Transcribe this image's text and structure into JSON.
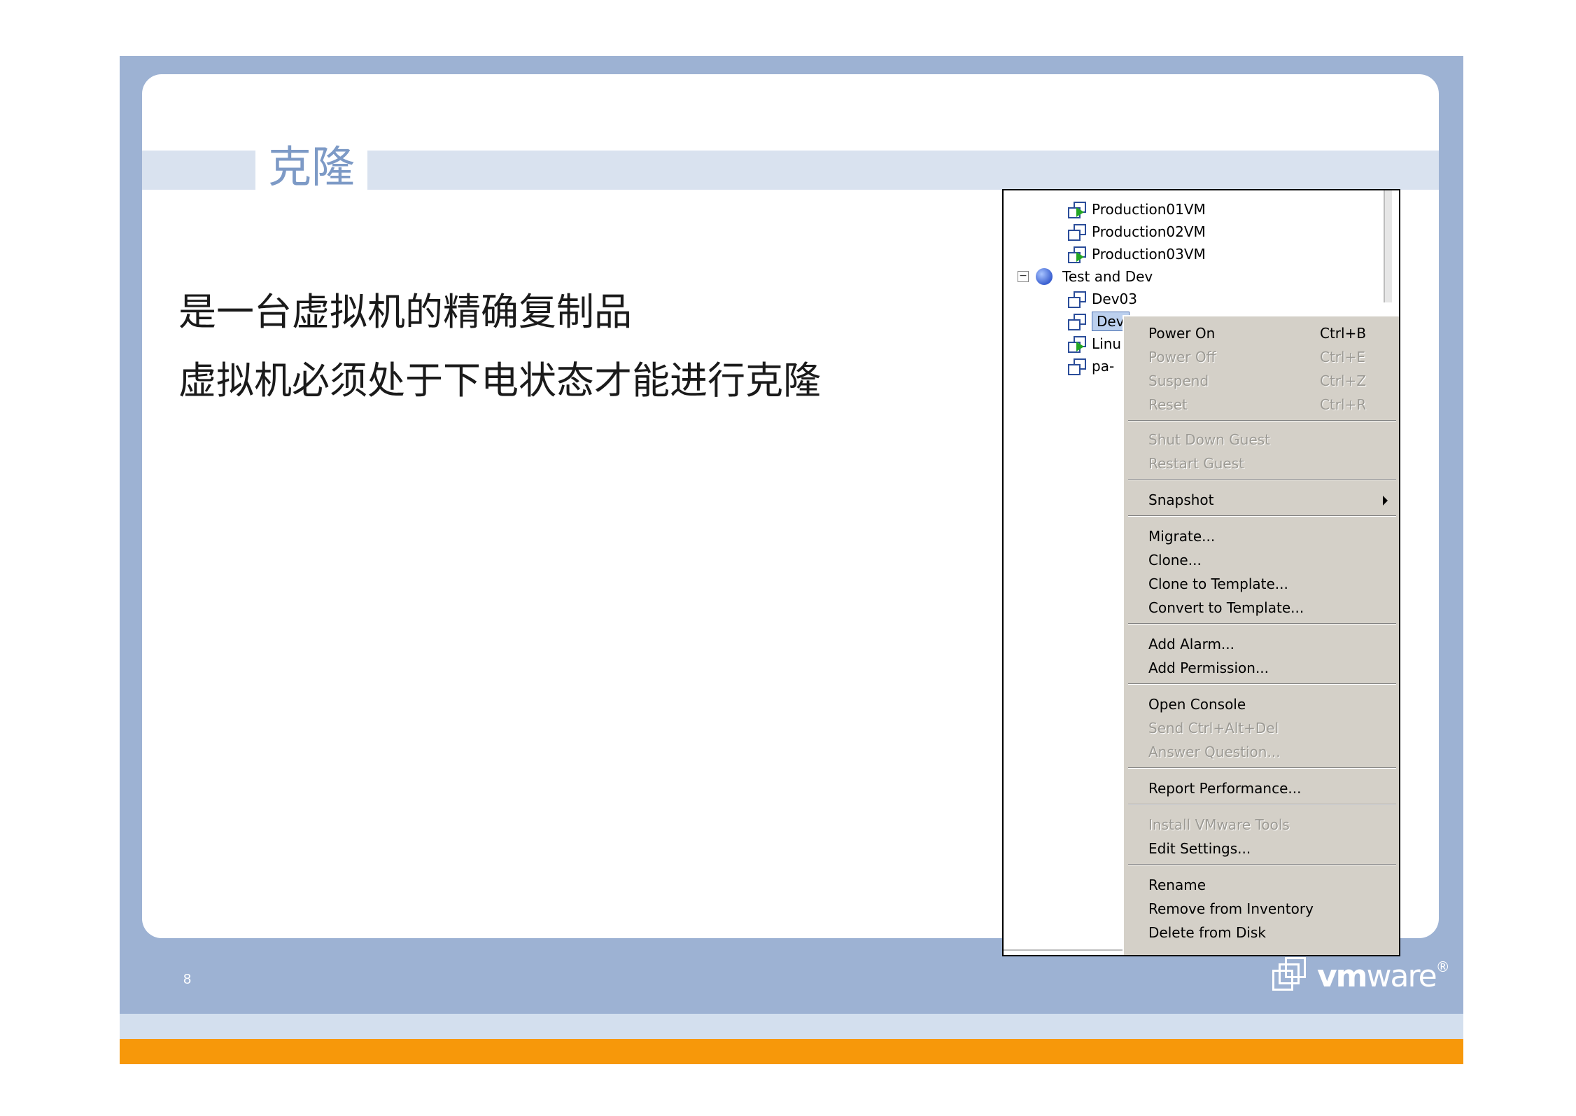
{
  "slide": {
    "title": "克隆",
    "lines": [
      "是一台虚拟机的精确复制品",
      "虚拟机必须处于下电状态才能进行克隆"
    ],
    "page_number": "8",
    "logo": {
      "brand": "vmware",
      "part1": "vm",
      "part2": "ware",
      "mark": "®"
    }
  },
  "tree": {
    "items": [
      {
        "label": "Production01VM",
        "icon": "vm-powered-on-icon"
      },
      {
        "label": "Production02VM",
        "icon": "vm-icon"
      },
      {
        "label": "Production03VM",
        "icon": "vm-powered-on-icon"
      },
      {
        "label": "Test and Dev",
        "icon": "resource-pool-icon",
        "expander": "−"
      },
      {
        "label": "Dev03",
        "icon": "vm-icon"
      },
      {
        "label": "Dev",
        "icon": "vm-icon",
        "selected": true
      },
      {
        "label": "Linu",
        "icon": "vm-powered-on-icon"
      },
      {
        "label": "pa-",
        "icon": "vm-icon"
      }
    ]
  },
  "context_menu": {
    "items": [
      {
        "label": "Power On",
        "shortcut": "Ctrl+B",
        "enabled": true
      },
      {
        "label": "Power Off",
        "shortcut": "Ctrl+E",
        "enabled": false
      },
      {
        "label": "Suspend",
        "shortcut": "Ctrl+Z",
        "enabled": false
      },
      {
        "label": "Reset",
        "shortcut": "Ctrl+R",
        "enabled": false
      },
      {
        "label": "Shut Down Guest",
        "enabled": false
      },
      {
        "label": "Restart Guest",
        "enabled": false
      },
      {
        "label": "Snapshot",
        "enabled": true,
        "submenu": true
      },
      {
        "label": "Migrate...",
        "enabled": true
      },
      {
        "label": "Clone...",
        "enabled": true
      },
      {
        "label": "Clone to Template...",
        "enabled": true
      },
      {
        "label": "Convert to Template...",
        "enabled": true
      },
      {
        "label": "Add Alarm...",
        "enabled": true
      },
      {
        "label": "Add Permission...",
        "enabled": true
      },
      {
        "label": "Open Console",
        "enabled": true
      },
      {
        "label": "Send Ctrl+Alt+Del",
        "enabled": false
      },
      {
        "label": "Answer Question...",
        "enabled": false
      },
      {
        "label": "Report Performance...",
        "enabled": true
      },
      {
        "label": "Install VMware Tools",
        "enabled": false
      },
      {
        "label": "Edit Settings...",
        "enabled": true
      },
      {
        "label": "Rename",
        "enabled": true
      },
      {
        "label": "Remove from Inventory",
        "enabled": true
      },
      {
        "label": "Delete from Disk",
        "enabled": true
      }
    ]
  },
  "colors": {
    "frame_blue": "#9db2d3",
    "title_blue": "#7d9ac6",
    "band_light": "#d9e2ef",
    "footer_orange": "#f7980a",
    "menu_bg": "#d4d0c8"
  }
}
